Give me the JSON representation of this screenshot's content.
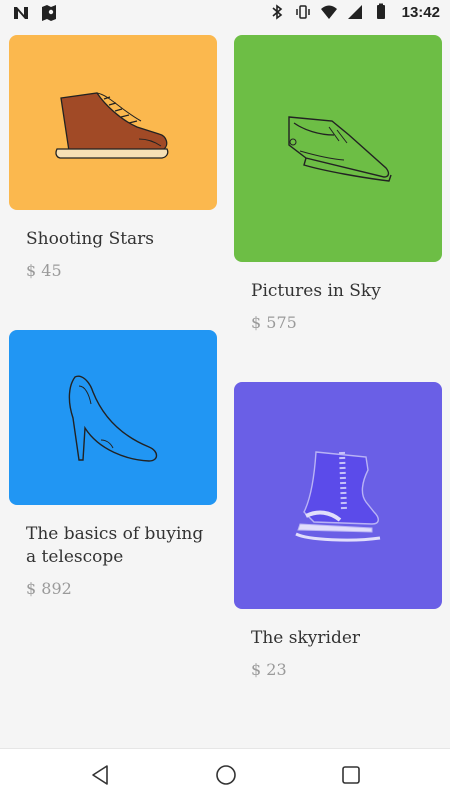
{
  "status_bar": {
    "time": "13:42",
    "left_icons": [
      "n-logo-icon",
      "map-icon"
    ],
    "right_icons": [
      "bluetooth-icon",
      "vibrate-icon",
      "wifi-icon",
      "signal-icon",
      "battery-icon"
    ]
  },
  "products": [
    {
      "title": "Shooting Stars",
      "price": "$ 45",
      "color": "#FBB84E",
      "icon": "sneaker-icon"
    },
    {
      "title": "Pictures in Sky",
      "price": "$ 575",
      "color": "#6DBE45",
      "icon": "sandal-icon"
    },
    {
      "title": "The basics of buying a telescope",
      "price": "$ 892",
      "color": "#2196F3",
      "icon": "high-heel-icon"
    },
    {
      "title": "The skyrider",
      "price": "$ 23",
      "color": "#6A5FE6",
      "icon": "ice-skate-icon"
    }
  ],
  "nav_bar": {
    "icons": [
      "back-icon",
      "home-icon",
      "recents-icon"
    ]
  }
}
